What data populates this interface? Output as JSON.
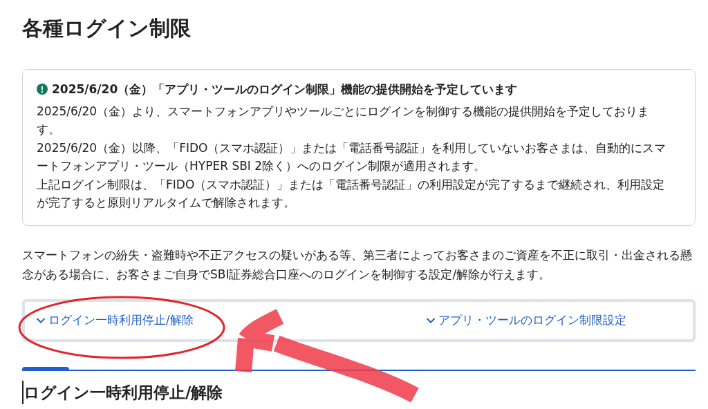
{
  "page": {
    "title": "各種ログイン制限"
  },
  "notice": {
    "heading": "2025/6/20（金）「アプリ・ツールのログイン制限」機能の提供開始を予定しています",
    "paragraphs": [
      "2025/6/20（金）より、スマートフォンアプリやツールごとにログインを制御する機能の提供開始を予定しております。",
      "2025/6/20（金）以降、「FIDO（スマホ認証）」または「電話番号認証」を利用していないお客さまは、自動的にスマートフォンアプリ・ツール（HYPER SBI 2除く）へのログイン制限が適用されます。",
      "上記ログイン制限は、「FIDO（スマホ認証）」または「電話番号認証」の利用設定が完了するまで継続され、利用設定が完了すると原則リアルタイムで解除されます。"
    ]
  },
  "intro": "スマートフォンの紛失・盗難時や不正アクセスの疑いがある等、第三者によってお客さまのご資産を不正に取引・出金される懸念がある場合に、お客さまご自身でSBI証券総合口座へのログインを制御する設定/解除が行えます。",
  "anchor_links": [
    {
      "label": "ログイン一時利用停止/解除"
    },
    {
      "label": "アプリ・ツールのログイン制限設定"
    }
  ],
  "section": {
    "heading": "ログイン一時利用停止/解除"
  },
  "markup": [
    {
      "kind": "ellipse"
    },
    {
      "kind": "arrow"
    }
  ]
}
